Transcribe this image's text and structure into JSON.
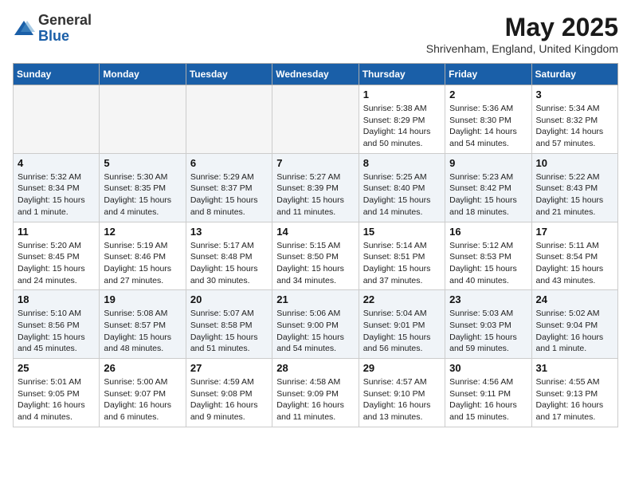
{
  "header": {
    "logo_general": "General",
    "logo_blue": "Blue",
    "month_title": "May 2025",
    "location": "Shrivenham, England, United Kingdom"
  },
  "weekdays": [
    "Sunday",
    "Monday",
    "Tuesday",
    "Wednesday",
    "Thursday",
    "Friday",
    "Saturday"
  ],
  "weeks": [
    [
      {
        "day": "",
        "content": ""
      },
      {
        "day": "",
        "content": ""
      },
      {
        "day": "",
        "content": ""
      },
      {
        "day": "",
        "content": ""
      },
      {
        "day": "1",
        "content": "Sunrise: 5:38 AM\nSunset: 8:29 PM\nDaylight: 14 hours\nand 50 minutes."
      },
      {
        "day": "2",
        "content": "Sunrise: 5:36 AM\nSunset: 8:30 PM\nDaylight: 14 hours\nand 54 minutes."
      },
      {
        "day": "3",
        "content": "Sunrise: 5:34 AM\nSunset: 8:32 PM\nDaylight: 14 hours\nand 57 minutes."
      }
    ],
    [
      {
        "day": "4",
        "content": "Sunrise: 5:32 AM\nSunset: 8:34 PM\nDaylight: 15 hours\nand 1 minute."
      },
      {
        "day": "5",
        "content": "Sunrise: 5:30 AM\nSunset: 8:35 PM\nDaylight: 15 hours\nand 4 minutes."
      },
      {
        "day": "6",
        "content": "Sunrise: 5:29 AM\nSunset: 8:37 PM\nDaylight: 15 hours\nand 8 minutes."
      },
      {
        "day": "7",
        "content": "Sunrise: 5:27 AM\nSunset: 8:39 PM\nDaylight: 15 hours\nand 11 minutes."
      },
      {
        "day": "8",
        "content": "Sunrise: 5:25 AM\nSunset: 8:40 PM\nDaylight: 15 hours\nand 14 minutes."
      },
      {
        "day": "9",
        "content": "Sunrise: 5:23 AM\nSunset: 8:42 PM\nDaylight: 15 hours\nand 18 minutes."
      },
      {
        "day": "10",
        "content": "Sunrise: 5:22 AM\nSunset: 8:43 PM\nDaylight: 15 hours\nand 21 minutes."
      }
    ],
    [
      {
        "day": "11",
        "content": "Sunrise: 5:20 AM\nSunset: 8:45 PM\nDaylight: 15 hours\nand 24 minutes."
      },
      {
        "day": "12",
        "content": "Sunrise: 5:19 AM\nSunset: 8:46 PM\nDaylight: 15 hours\nand 27 minutes."
      },
      {
        "day": "13",
        "content": "Sunrise: 5:17 AM\nSunset: 8:48 PM\nDaylight: 15 hours\nand 30 minutes."
      },
      {
        "day": "14",
        "content": "Sunrise: 5:15 AM\nSunset: 8:50 PM\nDaylight: 15 hours\nand 34 minutes."
      },
      {
        "day": "15",
        "content": "Sunrise: 5:14 AM\nSunset: 8:51 PM\nDaylight: 15 hours\nand 37 minutes."
      },
      {
        "day": "16",
        "content": "Sunrise: 5:12 AM\nSunset: 8:53 PM\nDaylight: 15 hours\nand 40 minutes."
      },
      {
        "day": "17",
        "content": "Sunrise: 5:11 AM\nSunset: 8:54 PM\nDaylight: 15 hours\nand 43 minutes."
      }
    ],
    [
      {
        "day": "18",
        "content": "Sunrise: 5:10 AM\nSunset: 8:56 PM\nDaylight: 15 hours\nand 45 minutes."
      },
      {
        "day": "19",
        "content": "Sunrise: 5:08 AM\nSunset: 8:57 PM\nDaylight: 15 hours\nand 48 minutes."
      },
      {
        "day": "20",
        "content": "Sunrise: 5:07 AM\nSunset: 8:58 PM\nDaylight: 15 hours\nand 51 minutes."
      },
      {
        "day": "21",
        "content": "Sunrise: 5:06 AM\nSunset: 9:00 PM\nDaylight: 15 hours\nand 54 minutes."
      },
      {
        "day": "22",
        "content": "Sunrise: 5:04 AM\nSunset: 9:01 PM\nDaylight: 15 hours\nand 56 minutes."
      },
      {
        "day": "23",
        "content": "Sunrise: 5:03 AM\nSunset: 9:03 PM\nDaylight: 15 hours\nand 59 minutes."
      },
      {
        "day": "24",
        "content": "Sunrise: 5:02 AM\nSunset: 9:04 PM\nDaylight: 16 hours\nand 1 minute."
      }
    ],
    [
      {
        "day": "25",
        "content": "Sunrise: 5:01 AM\nSunset: 9:05 PM\nDaylight: 16 hours\nand 4 minutes."
      },
      {
        "day": "26",
        "content": "Sunrise: 5:00 AM\nSunset: 9:07 PM\nDaylight: 16 hours\nand 6 minutes."
      },
      {
        "day": "27",
        "content": "Sunrise: 4:59 AM\nSunset: 9:08 PM\nDaylight: 16 hours\nand 9 minutes."
      },
      {
        "day": "28",
        "content": "Sunrise: 4:58 AM\nSunset: 9:09 PM\nDaylight: 16 hours\nand 11 minutes."
      },
      {
        "day": "29",
        "content": "Sunrise: 4:57 AM\nSunset: 9:10 PM\nDaylight: 16 hours\nand 13 minutes."
      },
      {
        "day": "30",
        "content": "Sunrise: 4:56 AM\nSunset: 9:11 PM\nDaylight: 16 hours\nand 15 minutes."
      },
      {
        "day": "31",
        "content": "Sunrise: 4:55 AM\nSunset: 9:13 PM\nDaylight: 16 hours\nand 17 minutes."
      }
    ]
  ]
}
